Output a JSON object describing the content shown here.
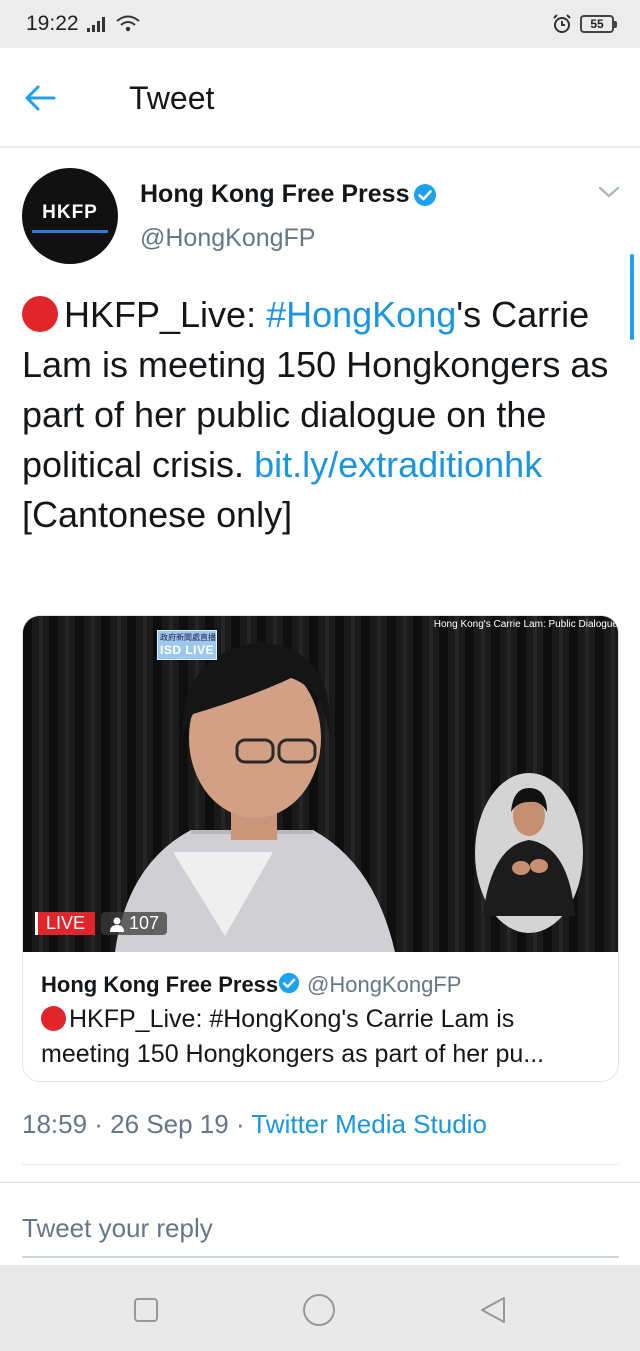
{
  "status_bar": {
    "time": "19:22",
    "battery": "55"
  },
  "app_bar": {
    "title": "Tweet"
  },
  "tweet": {
    "author_name": "Hong Kong Free Press",
    "author_handle": "@HongKongFP",
    "avatar_text": "HKFP",
    "text_part1": "HKFP_Live: ",
    "hashtag": "#HongKong",
    "text_part2": "'s Carrie Lam is meeting 150 Hongkongers as part of her public dialogue on the political crisis. ",
    "link": "bit.ly/extraditionhk",
    "text_part3": " [Cantonese only]",
    "timestamp": "18:59 · 26 Sep 19 · ",
    "source": "Twitter Media Studio"
  },
  "card": {
    "media_caption": "Hong Kong's Carrie Lam: Public Dialogue",
    "isd_top": "政府新聞處直播",
    "isd_live": "ISD LIVE",
    "live_label": "LIVE",
    "viewers": "107",
    "author_name": "Hong Kong Free Press",
    "author_handle": "@HongKongFP",
    "text": "HKFP_Live: #HongKong's Carrie Lam is meeting 150 Hongkongers as part of her pu..."
  },
  "reply": {
    "placeholder": "Tweet your reply"
  },
  "colors": {
    "accent": "#1b95e0",
    "live_red": "#e0262a",
    "secondary_text": "#657786"
  }
}
